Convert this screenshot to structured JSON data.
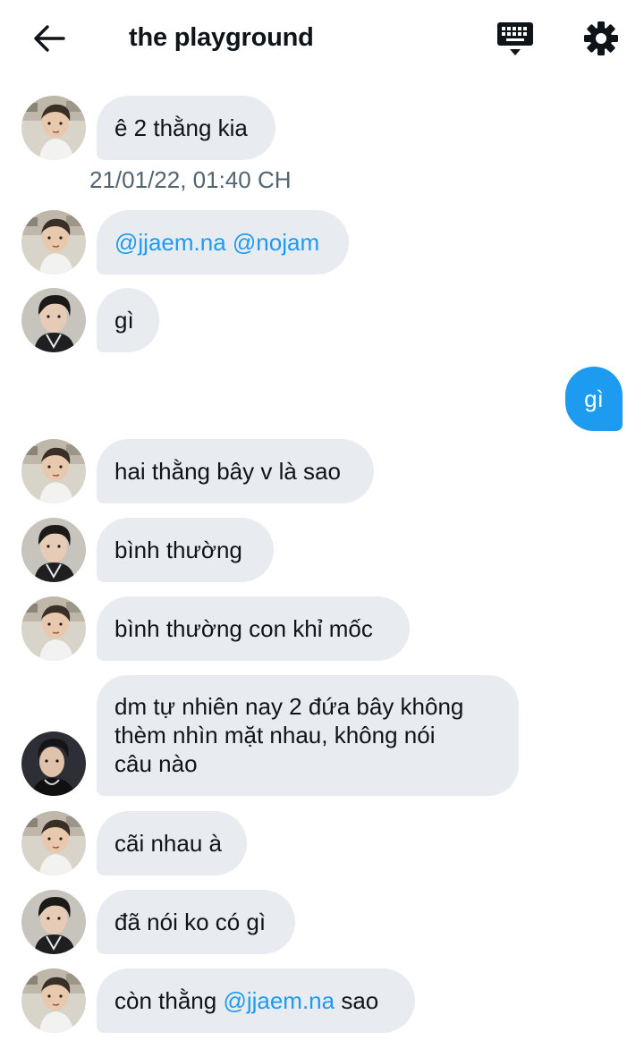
{
  "header": {
    "title": "the playground",
    "back_icon": "arrow-left-icon",
    "keyboard_icon": "keyboard-icon",
    "settings_icon": "gear-icon"
  },
  "colors": {
    "accent": "#1d9bf0",
    "bubble_in": "#e8ecf0",
    "text": "#0f1419",
    "muted": "#536471"
  },
  "messages": [
    {
      "sender": "avatar-a",
      "parts": [
        {
          "text": "ê 2 thằng kia"
        }
      ]
    },
    {
      "timestamp": "21/01/22, 01:40 CH"
    },
    {
      "sender": "avatar-a",
      "parts": [
        {
          "text": "@jjaem.na",
          "mention": true
        },
        {
          "text": " "
        },
        {
          "text": "@nojam",
          "mention": true
        }
      ]
    },
    {
      "sender": "avatar-b",
      "parts": [
        {
          "text": "gì"
        }
      ]
    },
    {
      "sender": "me",
      "parts": [
        {
          "text": "gì"
        }
      ]
    },
    {
      "sender": "avatar-a",
      "parts": [
        {
          "text": "hai thằng bây v là sao"
        }
      ]
    },
    {
      "sender": "avatar-b",
      "parts": [
        {
          "text": "bình thường"
        }
      ]
    },
    {
      "sender": "avatar-a",
      "parts": [
        {
          "text": "bình thường con khỉ mốc"
        }
      ]
    },
    {
      "sender": "avatar-c",
      "lines": [
        "dm tự nhiên nay 2 đứa bây không",
        "thèm nhìn mặt nhau, không nói",
        "câu nào"
      ]
    },
    {
      "sender": "avatar-a",
      "parts": [
        {
          "text": "cãi nhau à"
        }
      ]
    },
    {
      "sender": "avatar-b",
      "parts": [
        {
          "text": "đã nói ko có gì"
        }
      ]
    },
    {
      "sender": "avatar-a",
      "parts": [
        {
          "text": "còn thằng "
        },
        {
          "text": "@jjaem.na",
          "mention": true
        },
        {
          "text": " sao"
        }
      ]
    }
  ]
}
